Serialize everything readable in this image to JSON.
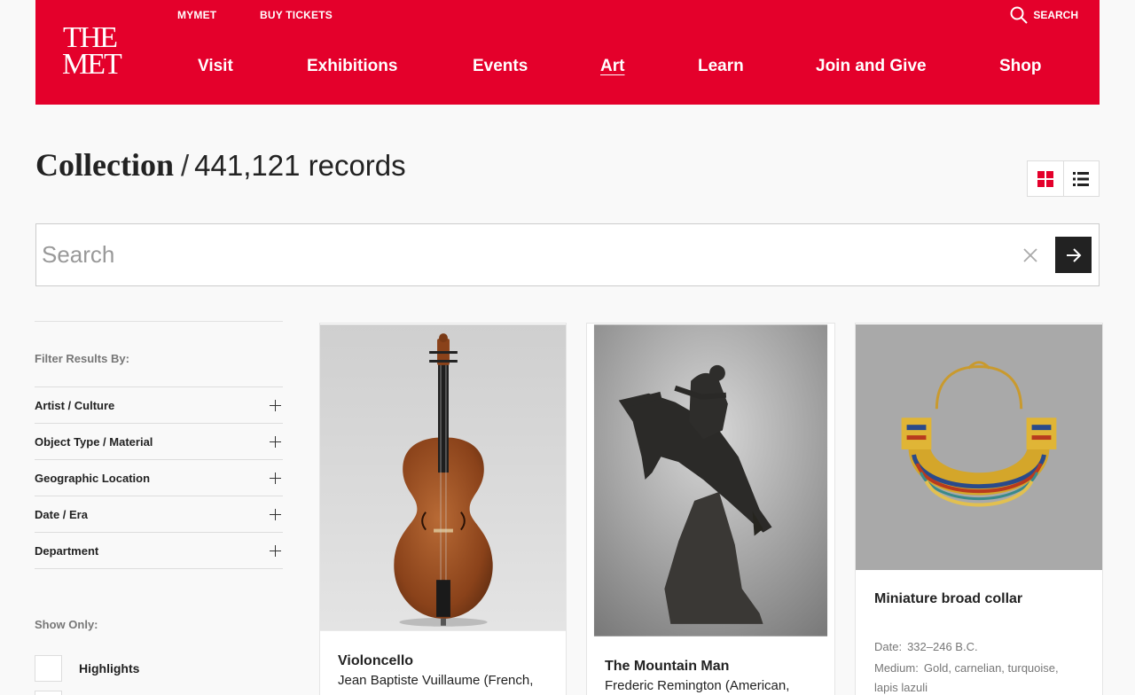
{
  "header": {
    "logo_line1": "THE",
    "logo_line2": "MET",
    "utility": {
      "mymet": "MYMET",
      "tickets": "BUY TICKETS",
      "search": "SEARCH"
    },
    "nav": [
      "Visit",
      "Exhibitions",
      "Events",
      "Art",
      "Learn",
      "Join and Give",
      "Shop"
    ],
    "active_nav": "Art"
  },
  "page": {
    "title": "Collection",
    "separator": "/",
    "record_count": "441,121 records"
  },
  "search": {
    "placeholder": "Search",
    "value": ""
  },
  "filters": {
    "heading": "Filter Results By:",
    "items": [
      "Artist / Culture",
      "Object Type / Material",
      "Geographic Location",
      "Date / Era",
      "Department"
    ],
    "show_only_heading": "Show Only:",
    "checkboxes": [
      "Highlights"
    ]
  },
  "results": [
    {
      "title": "Violoncello",
      "artist": "Jean Baptiste Vuillaume (French,",
      "date": "",
      "medium": ""
    },
    {
      "title": "The Mountain Man",
      "artist": "Frederic Remington (American,",
      "date": "",
      "medium": ""
    },
    {
      "title": "Miniature broad collar",
      "artist": "",
      "date_label": "Date:",
      "date": "332–246 B.C.",
      "medium_label": "Medium:",
      "medium": "Gold, carnelian, turquoise,",
      "medium_cont": "lapis lazuli"
    }
  ],
  "colors": {
    "brand_red": "#e4002b",
    "dark": "#222222",
    "muted": "#777777"
  },
  "icons": [
    "search-icon",
    "grid-view-icon",
    "list-view-icon",
    "clear-icon",
    "arrow-right-icon",
    "plus-icon"
  ]
}
